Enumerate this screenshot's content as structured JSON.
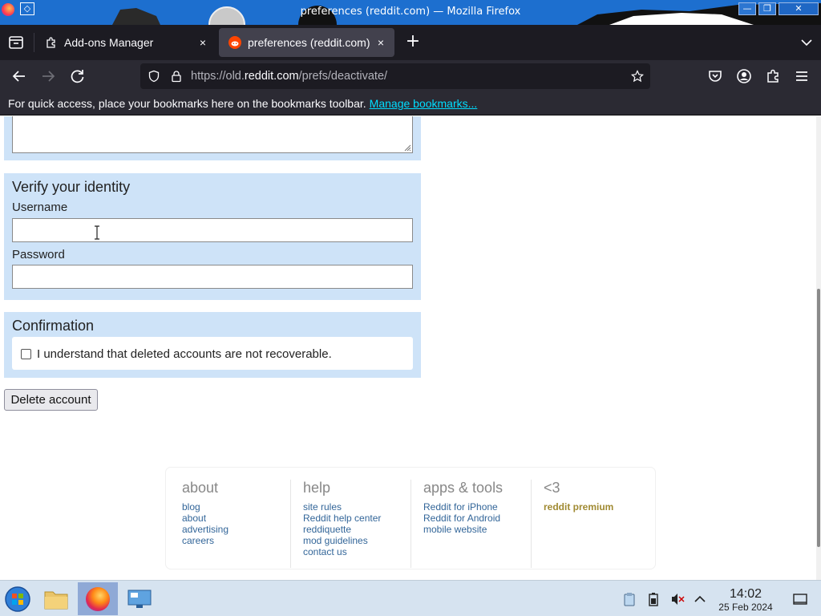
{
  "window": {
    "title": "preferences (reddit.com) — Mozilla Firefox",
    "minimize_glyph": "—",
    "maximize_glyph": "❐",
    "close_glyph": "✕"
  },
  "tabs": [
    {
      "label": "Add-ons Manager",
      "icon": "puzzle-icon",
      "active": false
    },
    {
      "label": "preferences (reddit.com)",
      "icon": "reddit-icon",
      "active": true
    }
  ],
  "tab_close_glyph": "×",
  "new_tab_glyph": "+",
  "urlbar": {
    "prefix": "https://old.",
    "host": "reddit.com",
    "path": "/prefs/deactivate/"
  },
  "bookmarks_bar": {
    "message": "For quick access, place your bookmarks here on the bookmarks toolbar.",
    "link": "Manage bookmarks..."
  },
  "verify_panel": {
    "title": "Verify your identity",
    "username_label": "Username",
    "username_value": "",
    "password_label": "Password",
    "password_value": ""
  },
  "confirmation_panel": {
    "title": "Confirmation",
    "checkbox_label": "I understand that deleted accounts are not recoverable.",
    "checked": false
  },
  "delete_button": "Delete account",
  "footer": {
    "columns": [
      {
        "title": "about",
        "links": [
          "blog",
          "about",
          "advertising",
          "careers"
        ]
      },
      {
        "title": "help",
        "links": [
          "site rules",
          "Reddit help center",
          "reddiquette",
          "mod guidelines",
          "contact us"
        ]
      },
      {
        "title": "apps & tools",
        "links": [
          "Reddit for iPhone",
          "Reddit for Android",
          "mobile website"
        ]
      },
      {
        "title": "<3",
        "links": [
          "reddit premium"
        ]
      }
    ]
  },
  "taskbar": {
    "time": "14:02",
    "date": "25 Feb 2024"
  },
  "colors": {
    "panel_bg": "#cee3f8",
    "link": "#336699",
    "premium": "#a08a32",
    "tab_strip": "#1c1b22",
    "toolbar": "#2b2a33",
    "bookmark_link": "#00ddff"
  }
}
